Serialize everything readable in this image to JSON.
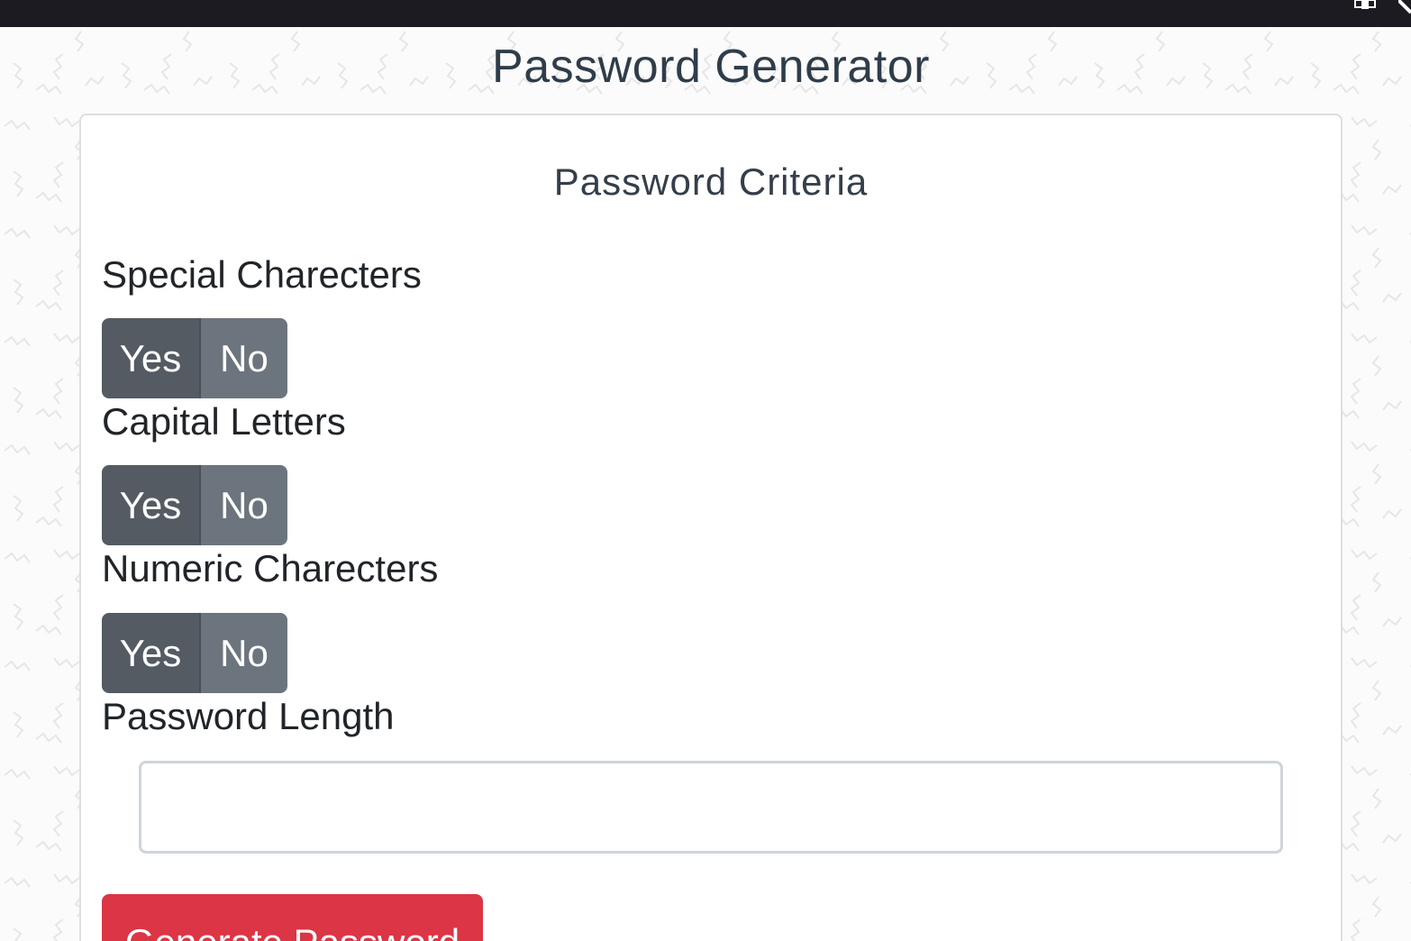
{
  "app": {
    "title": "Password Generator"
  },
  "card": {
    "header": "Password Criteria"
  },
  "criteria": [
    {
      "label": "Special Charecters",
      "yes_label": "Yes",
      "no_label": "No"
    },
    {
      "label": "Capital Letters",
      "yes_label": "Yes",
      "no_label": "No"
    },
    {
      "label": "Numeric Charecters",
      "yes_label": "Yes",
      "no_label": "No"
    }
  ],
  "length": {
    "label": "Password Length",
    "value": "",
    "placeholder": ""
  },
  "actions": {
    "generate_label": "Generate Password"
  },
  "colors": {
    "title": "#2f3d4a",
    "yes_button": "#545b62",
    "no_button": "#6c757d",
    "generate_button": "#dc3545",
    "topbar": "#1c1b22"
  },
  "icons": {
    "topbar_icon": "extension-icon"
  }
}
